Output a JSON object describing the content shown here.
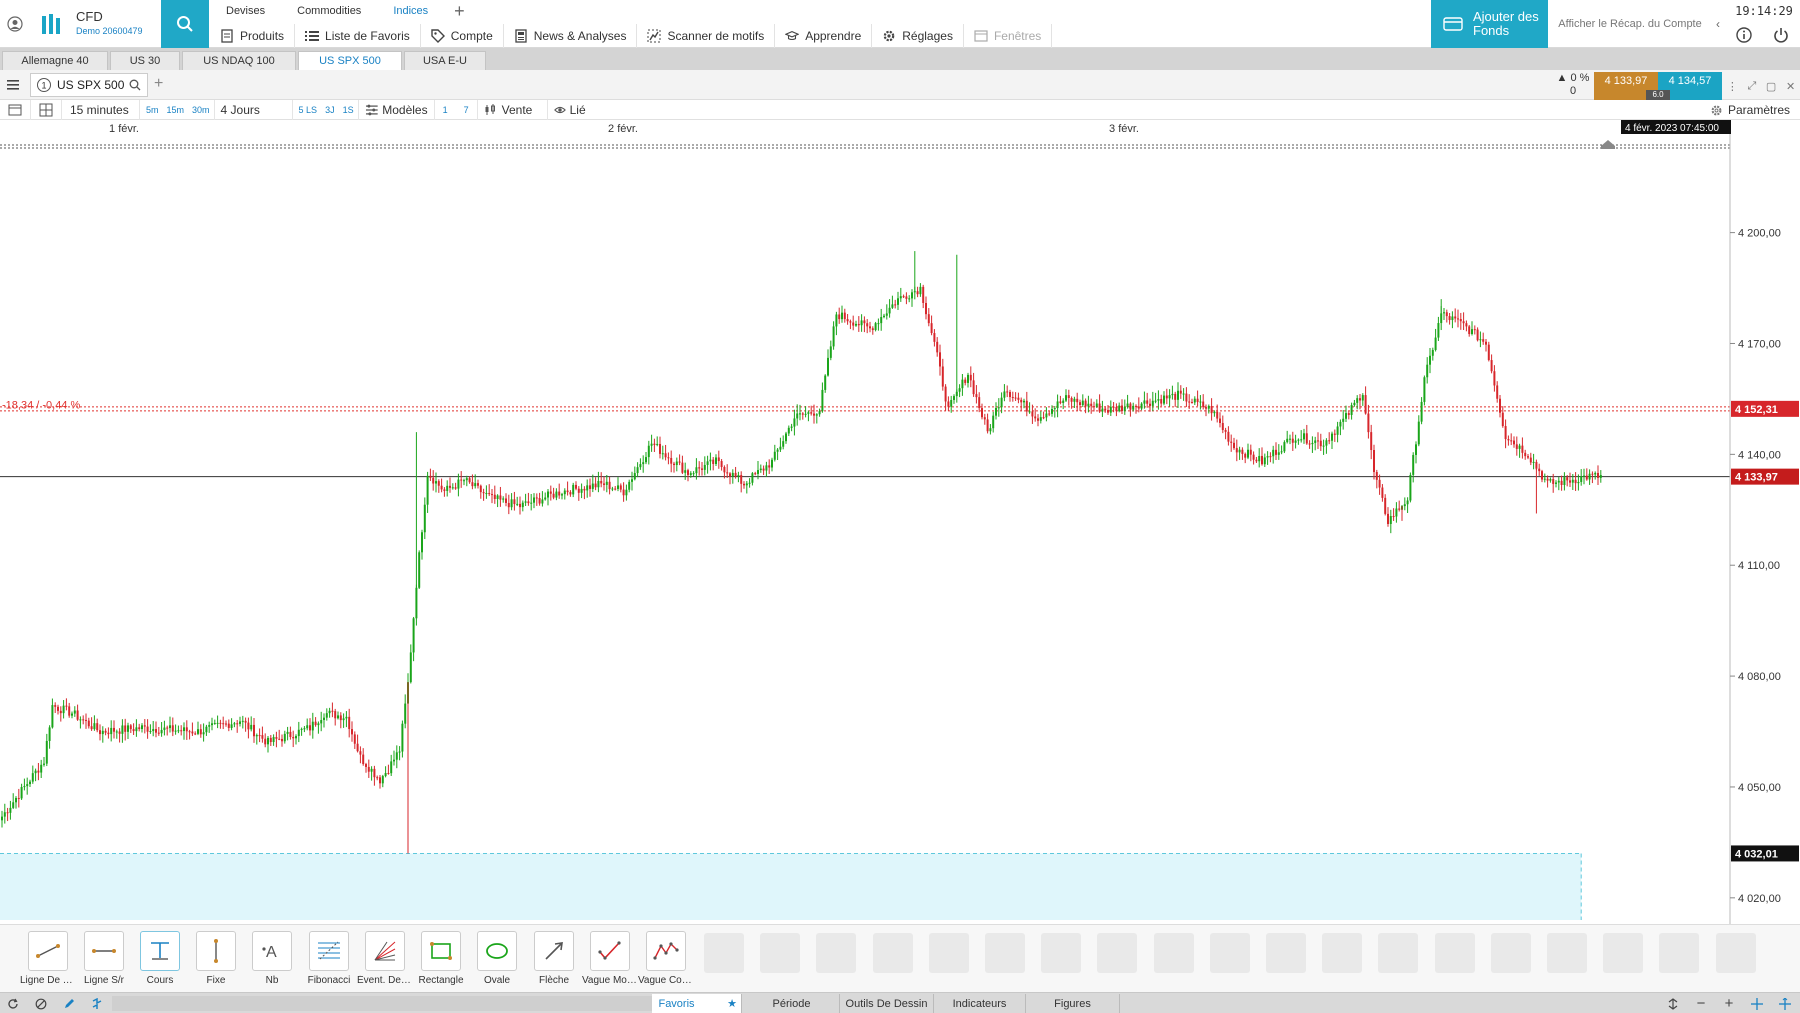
{
  "header": {
    "brand_name": "CFD",
    "account_label": "Demo 20600479",
    "market_tabs": [
      "Devises",
      "Commodities",
      "Indices"
    ],
    "active_market_tab": 2,
    "menu": [
      {
        "label": "Produits",
        "icon": "document-icon"
      },
      {
        "label": "Liste de Favoris",
        "icon": "list-icon"
      },
      {
        "label": "Compte",
        "icon": "tag-icon"
      },
      {
        "label": "News & Analyses",
        "icon": "news-icon"
      },
      {
        "label": "Scanner de motifs",
        "icon": "pattern-icon"
      },
      {
        "label": "Apprendre",
        "icon": "graduation-cap-icon"
      },
      {
        "label": "Réglages",
        "icon": "gear-icon"
      },
      {
        "label": "Fenêtres",
        "icon": "windows-icon"
      }
    ],
    "add_funds_label": "Ajouter des Fonds",
    "account_summary_label": "Afficher le Récap. du Compte",
    "clock": "19:14:29"
  },
  "instrument_tabs": [
    "Allemagne 40",
    "US 30",
    "US NDAQ 100",
    "US SPX 500",
    "USA E-U"
  ],
  "active_instrument": 3,
  "chart_tab": {
    "number": "1",
    "instrument": "US SPX 500",
    "change_percent": "▲ 0 %",
    "change_value": "0",
    "sell_price": "4 133,97",
    "buy_price": "4 134,57",
    "spread": "6.0"
  },
  "toolbar": {
    "timeframe": "15 minutes",
    "quick_timeframes": [
      "5m",
      "15m",
      "30m"
    ],
    "range": "4 Jours",
    "quick_ranges": [
      "5 LS",
      "3J",
      "1S"
    ],
    "models_label": "Modèles",
    "quick_models": [
      "1",
      "7"
    ],
    "side_label": "Vente",
    "linked_label": "Lié",
    "settings_label": "Paramètres"
  },
  "chart_data": {
    "type": "candlestick",
    "instrument": "US SPX 500",
    "interval": "15 minutes",
    "x_labels": [
      "1 févr.",
      "2 févr.",
      "3 févr."
    ],
    "cursor_time_label": "4 févr. 2023 07:45:00",
    "y_ticks": [
      4020,
      4050,
      4080,
      4110,
      4140,
      4170,
      4200
    ],
    "y_tick_labels": [
      "4 020,00",
      "4 050,00",
      "4 080,00",
      "4 110,00",
      "4 140,00",
      "4 170,00",
      "4 200,00"
    ],
    "ylim": [
      4014,
      4221
    ],
    "current_price": 4133.97,
    "current_price_label": "4 133,97",
    "reference_price": 4152.31,
    "reference_price_label": "4 152,31",
    "reference_change_label": "-18,34 / -0,44 %",
    "low_zone_price": 4032.01,
    "low_zone_label": "4 032,01",
    "colors": {
      "up": "#1aa51a",
      "down": "#d7262b",
      "reference": "#e0322f",
      "current": "#333333",
      "zone": "#dff6fb"
    },
    "anchors": [
      [
        0,
        4042
      ],
      [
        8,
        4050
      ],
      [
        15,
        4057
      ],
      [
        18,
        4072
      ],
      [
        25,
        4070
      ],
      [
        35,
        4065
      ],
      [
        50,
        4066
      ],
      [
        70,
        4065
      ],
      [
        85,
        4068
      ],
      [
        95,
        4062
      ],
      [
        110,
        4066
      ],
      [
        115,
        4070
      ],
      [
        123,
        4069
      ],
      [
        128,
        4058
      ],
      [
        135,
        4052
      ],
      [
        138,
        4055
      ],
      [
        142,
        4060
      ],
      [
        145,
        4078
      ],
      [
        148,
        4105
      ],
      [
        152,
        4135
      ],
      [
        158,
        4130
      ],
      [
        165,
        4133
      ],
      [
        175,
        4128
      ],
      [
        185,
        4126
      ],
      [
        200,
        4130
      ],
      [
        215,
        4132
      ],
      [
        222,
        4130
      ],
      [
        232,
        4143
      ],
      [
        245,
        4135
      ],
      [
        255,
        4138
      ],
      [
        265,
        4132
      ],
      [
        275,
        4138
      ],
      [
        283,
        4150
      ],
      [
        292,
        4152
      ],
      [
        298,
        4178
      ],
      [
        310,
        4174
      ],
      [
        320,
        4182
      ],
      [
        328,
        4185
      ],
      [
        333,
        4170
      ],
      [
        338,
        4152
      ],
      [
        345,
        4162
      ],
      [
        352,
        4146
      ],
      [
        358,
        4158
      ],
      [
        370,
        4150
      ],
      [
        380,
        4155
      ],
      [
        395,
        4152
      ],
      [
        408,
        4154
      ],
      [
        420,
        4156
      ],
      [
        432,
        4152
      ],
      [
        440,
        4142
      ],
      [
        450,
        4138
      ],
      [
        462,
        4145
      ],
      [
        472,
        4143
      ],
      [
        480,
        4150
      ],
      [
        486,
        4157
      ],
      [
        490,
        4135
      ],
      [
        495,
        4122
      ],
      [
        502,
        4128
      ],
      [
        508,
        4160
      ],
      [
        514,
        4178
      ],
      [
        522,
        4175
      ],
      [
        530,
        4170
      ],
      [
        537,
        4145
      ],
      [
        545,
        4140
      ],
      [
        552,
        4132
      ],
      [
        560,
        4133
      ],
      [
        566,
        4134
      ],
      [
        571,
        4134
      ]
    ]
  },
  "drawing_tools": [
    {
      "label": "Ligne De Tendance",
      "icon": "trend-line-icon"
    },
    {
      "label": "Ligne S/r",
      "icon": "support-resistance-icon"
    },
    {
      "label": "Cours",
      "icon": "price-line-icon"
    },
    {
      "label": "Fixe",
      "icon": "vertical-line-icon"
    },
    {
      "label": "Nb",
      "icon": "text-icon"
    },
    {
      "label": "Fibonacci",
      "icon": "fibonacci-icon"
    },
    {
      "label": "Évent. De Gann",
      "icon": "gann-fan-icon"
    },
    {
      "label": "Rectangle",
      "icon": "rectangle-icon"
    },
    {
      "label": "Ovale",
      "icon": "ellipse-icon"
    },
    {
      "label": "Flèche",
      "icon": "arrow-icon"
    },
    {
      "label": "Vague Motrice",
      "icon": "impulse-wave-icon"
    },
    {
      "label": "Vague Corrective",
      "icon": "corrective-wave-icon"
    }
  ],
  "status_tabs": [
    "Favoris",
    "Période",
    "Outils De Dessin",
    "Indicateurs",
    "Figures"
  ],
  "active_status_tab": 0
}
